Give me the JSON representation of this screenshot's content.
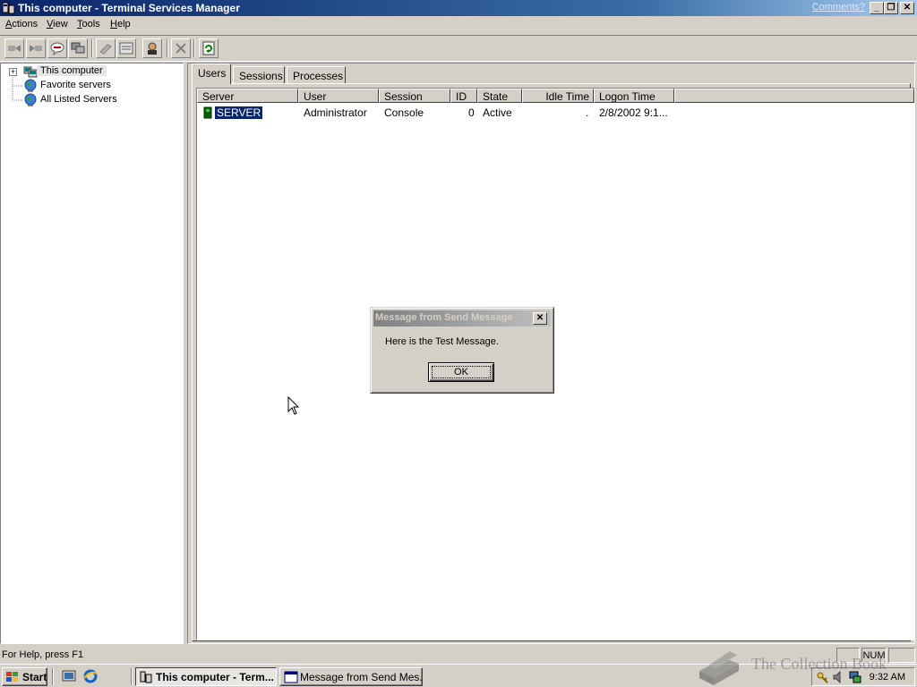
{
  "window": {
    "title": "This computer - Terminal Services Manager",
    "comments_link": "Comments?",
    "minimize_glyph": "_",
    "maximize_glyph": "❐",
    "close_glyph": "✕"
  },
  "menubar": {
    "items": [
      "Actions",
      "View",
      "Tools",
      "Help"
    ]
  },
  "toolbar": {
    "buttons": [
      "connect-icon",
      "disconnect-icon",
      "send-message-icon",
      "remote-control-icon",
      "reset-icon",
      "status-icon",
      "logoff-icon",
      "end-process-icon",
      "refresh-icon"
    ]
  },
  "tree": {
    "items": [
      {
        "label": "This computer",
        "icon": "computers-icon",
        "expander": "+"
      },
      {
        "label": "Favorite servers",
        "icon": "globe-icon"
      },
      {
        "label": "All Listed Servers",
        "icon": "globe-icon"
      }
    ]
  },
  "tabs": [
    "Users",
    "Sessions",
    "Processes"
  ],
  "active_tab": "Users",
  "list": {
    "columns": [
      "Server",
      "User",
      "Session",
      "ID",
      "State",
      "Idle Time",
      "Logon Time"
    ],
    "rows": [
      {
        "server": "SERVER",
        "user": "Administrator",
        "session": "Console",
        "id": "0",
        "state": "Active",
        "idle": ".",
        "logon": "2/8/2002 9:1..."
      }
    ]
  },
  "dialog": {
    "title": "Message from Send Message",
    "message": "Here is the Test Message.",
    "ok_label": "OK",
    "close_glyph": "✕"
  },
  "statusbar": {
    "help_text": "For Help, press F1",
    "num_indicator": "NUM"
  },
  "taskbar": {
    "start_label": "Start",
    "tasks": [
      "This computer - Term...",
      "Message from Send Mes..."
    ],
    "clock": "9:32 AM"
  },
  "watermark": {
    "text": "The Collection Book"
  },
  "colors": {
    "title_active": "#0a246a",
    "title_inactive": "#808080",
    "face": "#d4d0c8",
    "selection": "#0a246a"
  }
}
